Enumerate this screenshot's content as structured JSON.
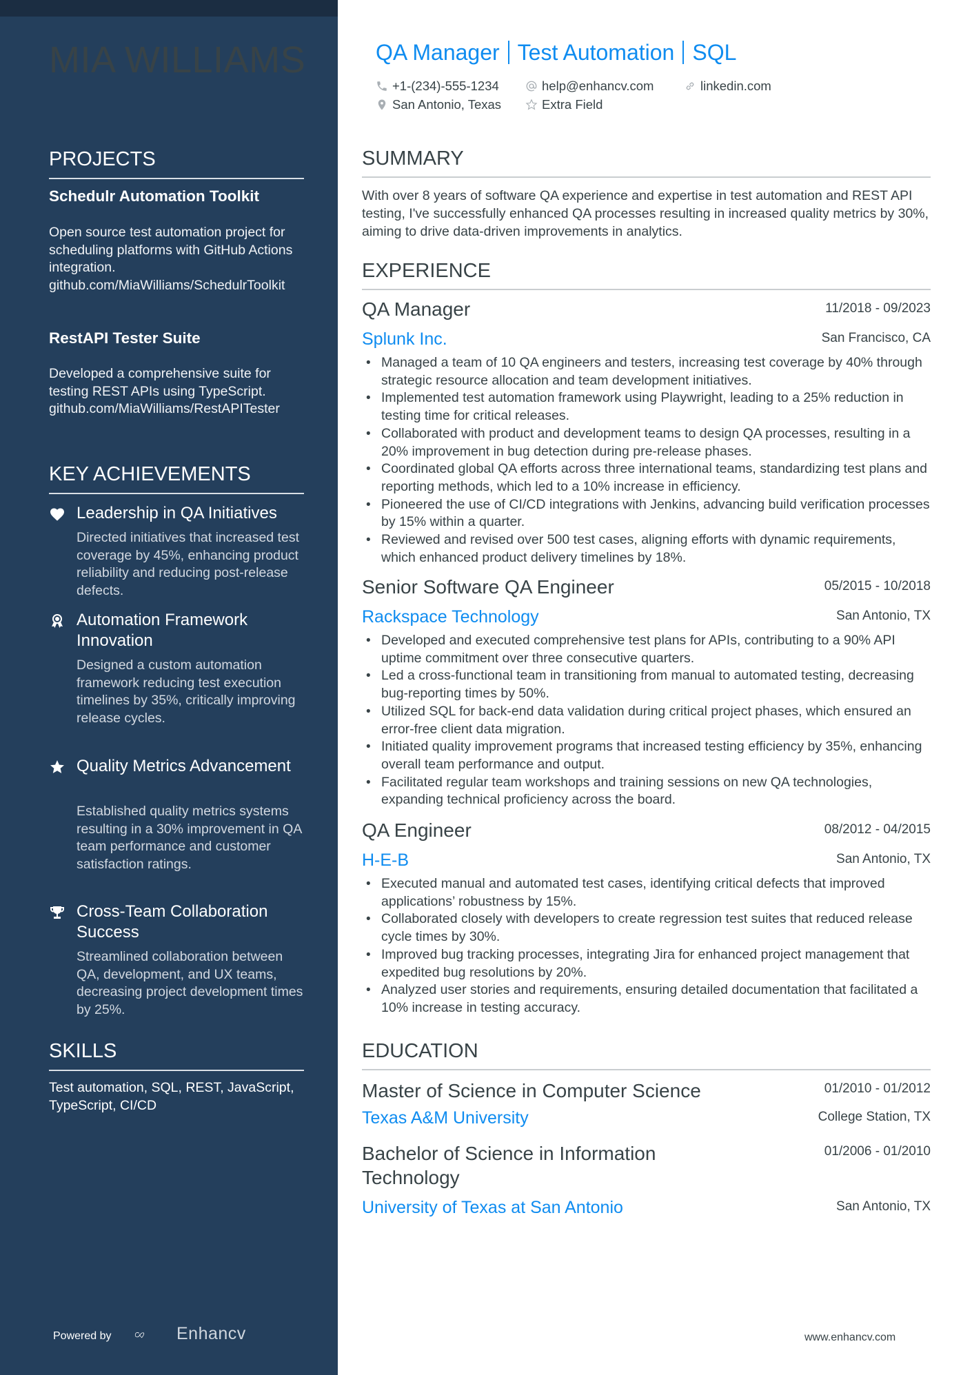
{
  "name": "MIA WILLIAMS",
  "headline": [
    "QA Manager",
    "Test Automation",
    "SQL"
  ],
  "contact": {
    "phone": "+1-(234)-555-1234",
    "email": "help@enhancv.com",
    "website": "linkedin.com",
    "location": "San Antonio, Texas",
    "extra": "Extra Field"
  },
  "colors": {
    "sidebar": "#243f5c",
    "accent": "#0f8cf0",
    "text": "#384347"
  },
  "sidebar": {
    "projects": {
      "heading": "PROJECTS",
      "items": [
        {
          "title": "Schedulr Automation Toolkit",
          "description": "Open source test automation project for scheduling platforms with GitHub Actions integration.",
          "link": "github.com/MiaWilliams/SchedulrToolkit"
        },
        {
          "title": "RestAPI Tester Suite",
          "description": "Developed a comprehensive suite for testing REST APIs using TypeScript.",
          "link": "github.com/MiaWilliams/RestAPITester"
        }
      ]
    },
    "achievements": {
      "heading": "KEY ACHIEVEMENTS",
      "items": [
        {
          "icon": "heart-icon",
          "title": "Leadership in QA Initiatives",
          "description": "Directed initiatives that increased test coverage by 45%, enhancing product reliability and reducing post-release defects."
        },
        {
          "icon": "award-ribbon-icon",
          "title": "Automation Framework Innovation",
          "description": "Designed a custom automation framework reducing test execution timelines by 35%, critically improving release cycles."
        },
        {
          "icon": "star-icon",
          "title": "Quality Metrics Advancement",
          "description": "Established quality metrics systems resulting in a 30% improvement in QA team performance and customer satisfaction ratings."
        },
        {
          "icon": "trophy-icon",
          "title": "Cross-Team Collaboration Success",
          "description": "Streamlined collaboration between QA, development, and UX teams, decreasing project development times by 25%."
        }
      ]
    },
    "skills": {
      "heading": "SKILLS",
      "text": "Test automation, SQL, REST, JavaScript, TypeScript, CI/CD"
    },
    "footer": {
      "powered_by": "Powered by",
      "brand": "Enhancv"
    }
  },
  "main": {
    "summary": {
      "heading": "SUMMARY",
      "text": "With over 8 years of software QA experience and expertise in test automation and REST API testing, I've successfully enhanced QA processes resulting in increased quality metrics by 30%, aiming to drive data-driven improvements in analytics."
    },
    "experience": {
      "heading": "EXPERIENCE",
      "jobs": [
        {
          "role": "QA Manager",
          "dates": "11/2018 - 09/2023",
          "company": "Splunk Inc.",
          "location": "San Francisco, CA",
          "bullets": [
            "Managed a team of 10 QA engineers and testers, increasing test coverage by 40% through strategic resource allocation and team development initiatives.",
            "Implemented test automation framework using Playwright, leading to a 25% reduction in testing time for critical releases.",
            "Collaborated with product and development teams to design QA processes, resulting in a 20% improvement in bug detection during pre-release phases.",
            "Coordinated global QA efforts across three international teams, standardizing test plans and reporting methods, which led to a 10% increase in efficiency.",
            "Pioneered the use of CI/CD integrations with Jenkins, advancing build verification processes by 15% within a quarter.",
            "Reviewed and revised over 500 test cases, aligning efforts with dynamic requirements, which enhanced product delivery timelines by 18%."
          ]
        },
        {
          "role": "Senior Software QA Engineer",
          "dates": "05/2015 - 10/2018",
          "company": "Rackspace Technology",
          "location": "San Antonio, TX",
          "bullets": [
            "Developed and executed comprehensive test plans for APIs, contributing to a 90% API uptime commitment over three consecutive quarters.",
            "Led a cross-functional team in transitioning from manual to automated testing, decreasing bug-reporting times by 50%.",
            "Utilized SQL for back-end data validation during critical project phases, which ensured an error-free client data migration.",
            "Initiated quality improvement programs that increased testing efficiency by 35%, enhancing overall team performance and output.",
            "Facilitated regular team workshops and training sessions on new QA technologies, expanding technical proficiency across the board."
          ]
        },
        {
          "role": "QA Engineer",
          "dates": "08/2012 - 04/2015",
          "company": "H-E-B",
          "location": "San Antonio, TX",
          "bullets": [
            "Executed manual and automated test cases, identifying critical defects that improved applications’ robustness by 15%.",
            "Collaborated closely with developers to create regression test suites that reduced release cycle times by 30%.",
            "Improved bug tracking processes, integrating Jira for enhanced project management that expedited bug resolutions by 20%.",
            "Analyzed user stories and requirements, ensuring detailed documentation that facilitated a 10% increase in testing accuracy."
          ]
        }
      ]
    },
    "education": {
      "heading": "EDUCATION",
      "items": [
        {
          "degree": "Master of Science in Computer Science",
          "dates": "01/2010 - 01/2012",
          "school": "Texas A&M University",
          "location": "College Station, TX"
        },
        {
          "degree": "Bachelor of Science in Information Technology",
          "dates": "01/2006 - 01/2010",
          "school": "University of Texas at San Antonio",
          "location": "San Antonio, TX"
        }
      ]
    },
    "footer": {
      "website": "www.enhancv.com"
    }
  }
}
